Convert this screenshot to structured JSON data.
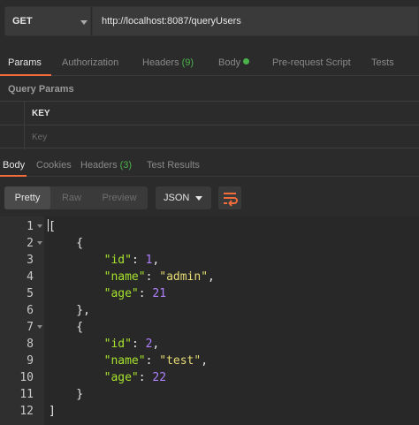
{
  "request": {
    "method": "GET",
    "url": "http://localhost:8087/queryUsers"
  },
  "request_tabs": [
    {
      "label": "Params",
      "active": true
    },
    {
      "label": "Authorization"
    },
    {
      "label": "Headers",
      "count": "(9)"
    },
    {
      "label": "Body",
      "indicator": "green-dot"
    },
    {
      "label": "Pre-request Script"
    },
    {
      "label": "Tests"
    }
  ],
  "query_params": {
    "title": "Query Params",
    "header_key": "KEY",
    "placeholder_key": "Key"
  },
  "response_tabs": [
    {
      "label": "Body",
      "active": true
    },
    {
      "label": "Cookies"
    },
    {
      "label": "Headers",
      "count": "(3)"
    },
    {
      "label": "Test Results"
    }
  ],
  "view_modes": [
    "Pretty",
    "Raw",
    "Preview"
  ],
  "active_view_mode": "Pretty",
  "format_select": "JSON",
  "colors": {
    "accent": "#f26b3a",
    "count_green": "#4bb34b",
    "json_key": "#a6e22e",
    "json_string": "#e6db74",
    "json_number": "#ae81ff"
  },
  "code_lines": [
    {
      "num": "1",
      "fold": true,
      "tokens": [
        {
          "t": "p",
          "v": "["
        }
      ]
    },
    {
      "num": "2",
      "fold": true,
      "tokens": [
        {
          "t": "p",
          "v": "    {"
        }
      ]
    },
    {
      "num": "3",
      "fold": false,
      "tokens": [
        {
          "t": "p",
          "v": "        "
        },
        {
          "t": "k",
          "v": "\"id\""
        },
        {
          "t": "p",
          "v": ": "
        },
        {
          "t": "n",
          "v": "1"
        },
        {
          "t": "p",
          "v": ","
        }
      ]
    },
    {
      "num": "4",
      "fold": false,
      "tokens": [
        {
          "t": "p",
          "v": "        "
        },
        {
          "t": "k",
          "v": "\"name\""
        },
        {
          "t": "p",
          "v": ": "
        },
        {
          "t": "s",
          "v": "\"admin\""
        },
        {
          "t": "p",
          "v": ","
        }
      ]
    },
    {
      "num": "5",
      "fold": false,
      "tokens": [
        {
          "t": "p",
          "v": "        "
        },
        {
          "t": "k",
          "v": "\"age\""
        },
        {
          "t": "p",
          "v": ": "
        },
        {
          "t": "n",
          "v": "21"
        }
      ]
    },
    {
      "num": "6",
      "fold": false,
      "tokens": [
        {
          "t": "p",
          "v": "    },"
        }
      ]
    },
    {
      "num": "7",
      "fold": true,
      "tokens": [
        {
          "t": "p",
          "v": "    {"
        }
      ]
    },
    {
      "num": "8",
      "fold": false,
      "tokens": [
        {
          "t": "p",
          "v": "        "
        },
        {
          "t": "k",
          "v": "\"id\""
        },
        {
          "t": "p",
          "v": ": "
        },
        {
          "t": "n",
          "v": "2"
        },
        {
          "t": "p",
          "v": ","
        }
      ]
    },
    {
      "num": "9",
      "fold": false,
      "tokens": [
        {
          "t": "p",
          "v": "        "
        },
        {
          "t": "k",
          "v": "\"name\""
        },
        {
          "t": "p",
          "v": ": "
        },
        {
          "t": "s",
          "v": "\"test\""
        },
        {
          "t": "p",
          "v": ","
        }
      ]
    },
    {
      "num": "10",
      "fold": false,
      "tokens": [
        {
          "t": "p",
          "v": "        "
        },
        {
          "t": "k",
          "v": "\"age\""
        },
        {
          "t": "p",
          "v": ": "
        },
        {
          "t": "n",
          "v": "22"
        }
      ]
    },
    {
      "num": "11",
      "fold": false,
      "tokens": [
        {
          "t": "p",
          "v": "    }"
        }
      ]
    },
    {
      "num": "12",
      "fold": false,
      "tokens": [
        {
          "t": "p",
          "v": "]"
        }
      ]
    }
  ]
}
